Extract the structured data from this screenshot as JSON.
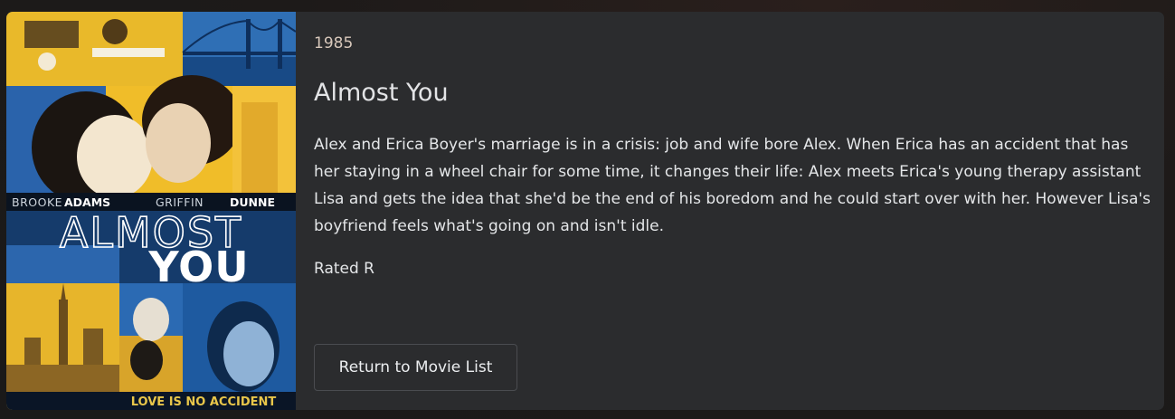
{
  "movie": {
    "year": "1985",
    "title": "Almost You",
    "synopsis": "Alex and Erica Boyer's marriage is in a crisis: job and wife bore Alex. When Erica has an accident that has her staying in a wheel chair for some time, it changes their life: Alex meets Erica's young therapy assistant Lisa and gets the idea that she'd be the end of his boredom and he could start over with her. However Lisa's boyfriend feels what's going on and isn't idle.",
    "rating": "Rated R"
  },
  "poster": {
    "actor_1_first": "BROOKE",
    "actor_1_last": "ADAMS",
    "actor_2_first": "GRIFFIN",
    "actor_2_last": "DUNNE",
    "title_line_1": "ALMOST",
    "title_line_2": "YOU",
    "tagline": "LOVE IS NO ACCIDENT",
    "accent_color": "#f2c12e",
    "blue_color": "#1f5fa8"
  },
  "actions": {
    "return_label": "Return to Movie List"
  }
}
